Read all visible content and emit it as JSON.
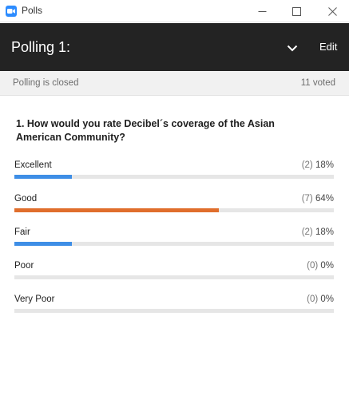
{
  "window": {
    "title": "Polls",
    "icon": "zoom-camera-icon"
  },
  "header": {
    "title": "Polling 1:",
    "edit_label": "Edit",
    "dropdown_icon": "chevron-down-icon"
  },
  "status": {
    "state": "Polling is closed",
    "voted": "11 voted"
  },
  "question": {
    "text": "1. How would you rate Decibel´s coverage of the Asian American Community?"
  },
  "options": [
    {
      "label": "Excellent",
      "count": "(2)",
      "percent": "18%",
      "fraction": 0.18,
      "color": "#3e8ee6"
    },
    {
      "label": "Good",
      "count": "(7)",
      "percent": "64%",
      "fraction": 0.64,
      "color": "#e06e2c"
    },
    {
      "label": "Fair",
      "count": "(2)",
      "percent": "18%",
      "fraction": 0.18,
      "color": "#3e8ee6"
    },
    {
      "label": "Poor",
      "count": "(0)",
      "percent": "0%",
      "fraction": 0,
      "color": "#3e8ee6"
    },
    {
      "label": "Very Poor",
      "count": "(0)",
      "percent": "0%",
      "fraction": 0,
      "color": "#3e8ee6"
    }
  ],
  "colors": {
    "brand": "#2d8cff",
    "header_bg": "#232323",
    "bar_track": "#e6e6e6",
    "bar_blue": "#3e8ee6",
    "bar_orange": "#e06e2c"
  }
}
